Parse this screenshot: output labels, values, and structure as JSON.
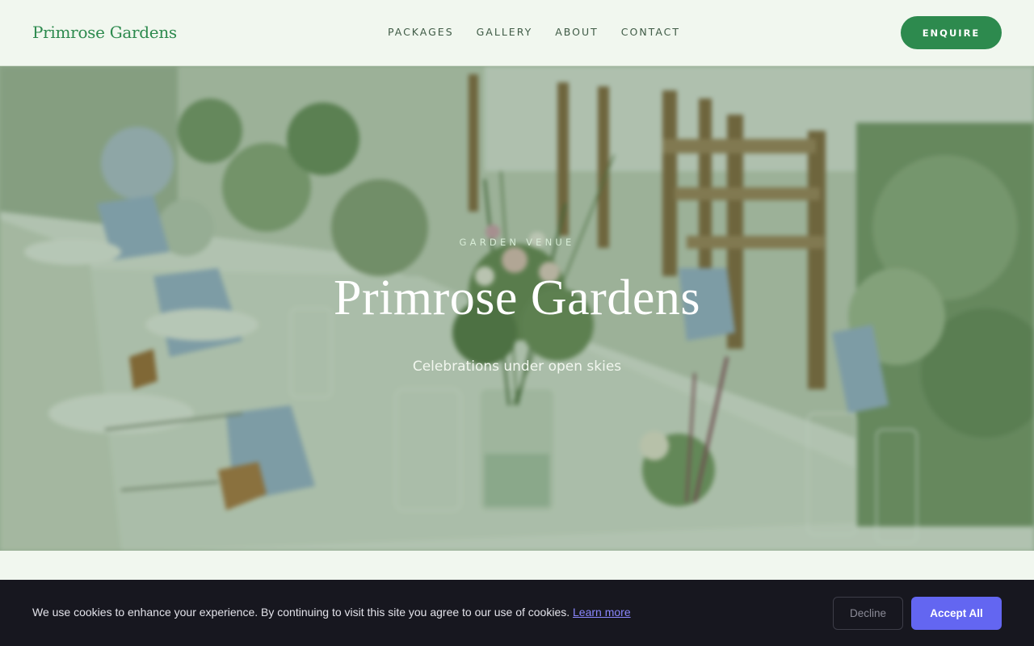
{
  "header": {
    "logo": "Primrose Gardens",
    "nav": [
      "PACKAGES",
      "GALLERY",
      "ABOUT",
      "CONTACT"
    ],
    "cta": "ENQUIRE"
  },
  "hero": {
    "eyebrow": "GARDEN VENUE",
    "title": "Primrose Gardens",
    "subtitle": "Celebrations under open skies",
    "image": "wedding-table-flowers-photo"
  },
  "cookie_banner": {
    "message": "We use cookies to enhance your experience. By continuing to visit this site you agree to our use of cookies.",
    "link": "Learn more",
    "decline": "Decline",
    "accept": "Accept All"
  },
  "colors": {
    "brand_green": "#2d8a4e",
    "page_bg": "#f1f7ef",
    "banner_bg": "#17171f",
    "accept_bg": "#6366f1",
    "link": "#8b87ff"
  }
}
